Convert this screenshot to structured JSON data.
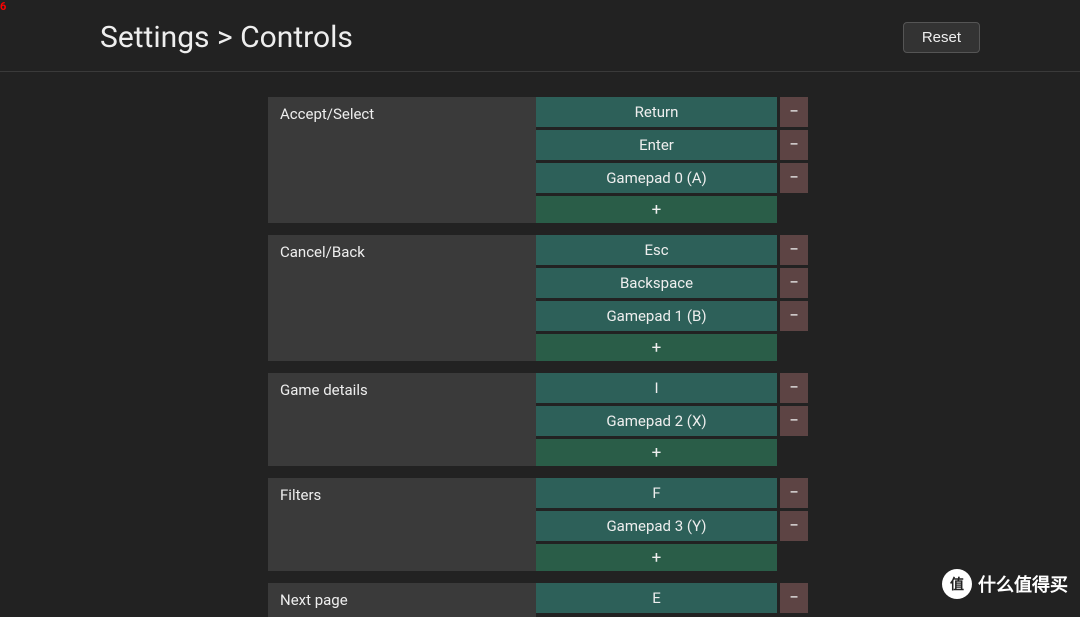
{
  "debug_number": "6",
  "header": {
    "breadcrumb": "Settings > Controls",
    "reset_label": "Reset"
  },
  "symbols": {
    "remove": "−",
    "add": "+"
  },
  "sections": [
    {
      "label": "Accept/Select",
      "bindings": [
        "Return",
        "Enter",
        "Gamepad 0 (A)"
      ]
    },
    {
      "label": "Cancel/Back",
      "bindings": [
        "Esc",
        "Backspace",
        "Gamepad 1 (B)"
      ]
    },
    {
      "label": "Game details",
      "bindings": [
        "I",
        "Gamepad 2 (X)"
      ]
    },
    {
      "label": "Filters",
      "bindings": [
        "F",
        "Gamepad 3 (Y)"
      ]
    },
    {
      "label": "Next page",
      "bindings": [
        "E"
      ]
    }
  ],
  "watermark": {
    "badge": "值",
    "text": "什么值得买"
  }
}
